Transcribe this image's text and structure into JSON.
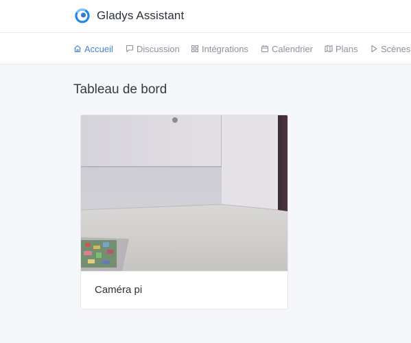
{
  "app": {
    "name": "Gladys Assistant"
  },
  "nav": {
    "items": [
      {
        "label": "Accueil",
        "icon": "home-icon",
        "active": true
      },
      {
        "label": "Discussion",
        "icon": "message-icon",
        "active": false
      },
      {
        "label": "Intégrations",
        "icon": "grid-icon",
        "active": false
      },
      {
        "label": "Calendrier",
        "icon": "calendar-icon",
        "active": false
      },
      {
        "label": "Plans",
        "icon": "map-icon",
        "active": false
      },
      {
        "label": "Scènes",
        "icon": "play-icon",
        "active": false
      }
    ]
  },
  "page": {
    "title": "Tableau de bord"
  },
  "dashboard": {
    "cards": [
      {
        "title": "Caméra pi",
        "content": "camera-snapshot"
      }
    ]
  },
  "colors": {
    "accent": "#467fcf",
    "nav_text": "#8a929c",
    "background": "#f5f7fb",
    "logo_blue": "#1e88e5"
  }
}
